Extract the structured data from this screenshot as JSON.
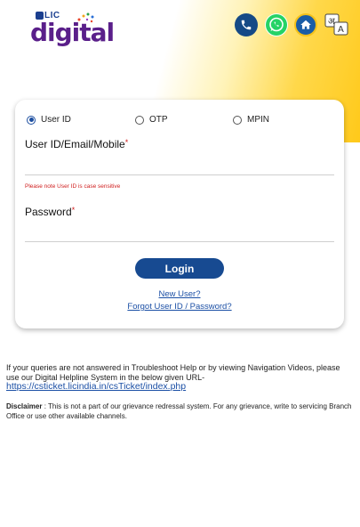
{
  "brand": {
    "lic": "LIC",
    "digital": "digital"
  },
  "header_icons": {
    "phone": "phone-icon",
    "whatsapp": "whatsapp-icon",
    "home": "home-icon",
    "language": "language-icon",
    "language_glyph_a": "अ",
    "language_glyph_b": "A"
  },
  "login": {
    "options": [
      {
        "label": "User ID",
        "selected": true
      },
      {
        "label": "OTP",
        "selected": false
      },
      {
        "label": "MPIN",
        "selected": false
      }
    ],
    "userid_label": "User ID/Email/Mobile",
    "required_mark": "*",
    "userid_value": "",
    "case_note": "Please note User ID is case sensitive",
    "password_label": "Password",
    "password_value": "",
    "login_button": "Login",
    "new_user_link": "New User?",
    "forgot_link": "Forgot User ID / Password?"
  },
  "help": {
    "text": "If your queries are not answered in Troubleshoot Help or by viewing Navigation Videos, please use our Digital Helpline System in the below given URL-",
    "url": "https://csticket.licindia.in/csTicket/index.php"
  },
  "disclaimer": {
    "title": "Disclaimer",
    "text": " : This is not a part of our grievance redressal system. For any grievance, write to servicing Branch Office or use other available channels."
  },
  "colors": {
    "primary": "#174a91",
    "accent_yellow": "#ffc91a",
    "error_red": "#d02020",
    "link_blue": "#1b4fa5",
    "whatsapp_green": "#25d366"
  }
}
